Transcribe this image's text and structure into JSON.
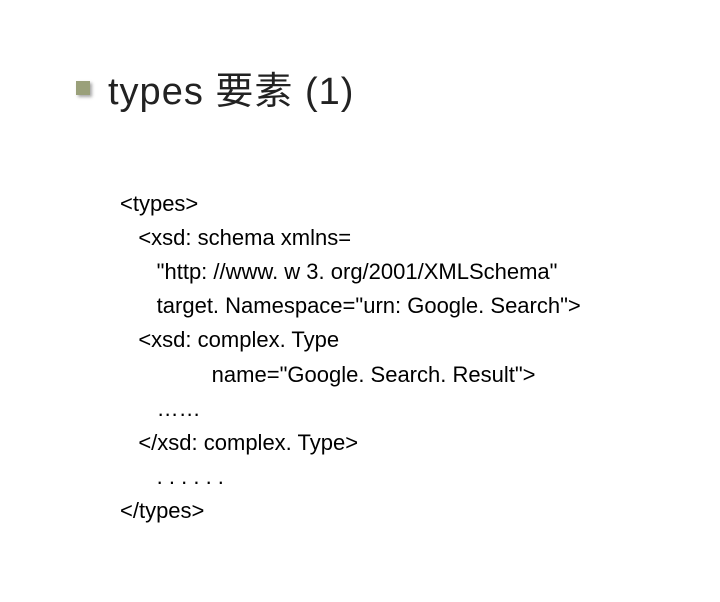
{
  "title": "types 要素 (1)",
  "code": {
    "l1": "<types>",
    "l2": "   <xsd: schema xmlns=",
    "l3": "      \"http: //www. w 3. org/2001/XMLSchema\"",
    "l4": "      target. Namespace=\"urn: Google. Search\">",
    "l5": "   <xsd: complex. Type",
    "l6": "               name=\"Google. Search. Result\">",
    "l7": "      ……",
    "l8": "   </xsd: complex. Type>",
    "l9": "      . . . . . .",
    "l10": "</types>"
  }
}
